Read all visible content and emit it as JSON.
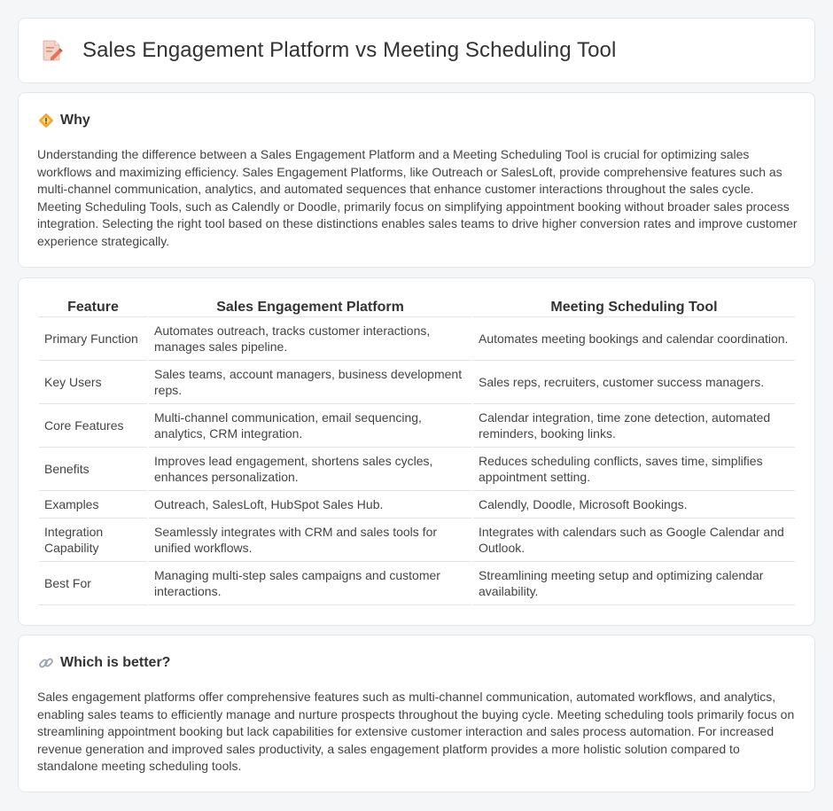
{
  "header": {
    "title": "Sales Engagement Platform vs Meeting Scheduling Tool",
    "icon": "document-pencil-icon"
  },
  "why": {
    "heading": "Why",
    "icon": "diamond-sign-icon",
    "body": "Understanding the difference between a Sales Engagement Platform and a Meeting Scheduling Tool is crucial for optimizing sales workflows and maximizing efficiency. Sales Engagement Platforms, like Outreach or SalesLoft, provide comprehensive features such as multi-channel communication, analytics, and automated sequences that enhance customer interactions throughout the sales cycle. Meeting Scheduling Tools, such as Calendly or Doodle, primarily focus on simplifying appointment booking without broader sales process integration. Selecting the right tool based on these distinctions enables sales teams to drive higher conversion rates and improve customer experience strategically."
  },
  "table": {
    "headers": [
      "Feature",
      "Sales Engagement Platform",
      "Meeting Scheduling Tool"
    ],
    "rows": [
      {
        "feature": "Primary Function",
        "sep": "Automates outreach, tracks customer interactions, manages sales pipeline.",
        "mst": "Automates meeting bookings and calendar coordination."
      },
      {
        "feature": "Key Users",
        "sep": "Sales teams, account managers, business development reps.",
        "mst": "Sales reps, recruiters, customer success managers."
      },
      {
        "feature": "Core Features",
        "sep": "Multi-channel communication, email sequencing, analytics, CRM integration.",
        "mst": "Calendar integration, time zone detection, automated reminders, booking links."
      },
      {
        "feature": "Benefits",
        "sep": "Improves lead engagement, shortens sales cycles, enhances personalization.",
        "mst": "Reduces scheduling conflicts, saves time, simplifies appointment setting."
      },
      {
        "feature": "Examples",
        "sep": "Outreach, SalesLoft, HubSpot Sales Hub.",
        "mst": "Calendly, Doodle, Microsoft Bookings."
      },
      {
        "feature": "Integration Capability",
        "sep": "Seamlessly integrates with CRM and sales tools for unified workflows.",
        "mst": "Integrates with calendars such as Google Calendar and Outlook."
      },
      {
        "feature": "Best For",
        "sep": "Managing multi-step sales campaigns and customer interactions.",
        "mst": "Streamlining meeting setup and optimizing calendar availability."
      }
    ]
  },
  "better": {
    "heading": "Which is better?",
    "icon": "link-icon",
    "body": "Sales engagement platforms offer comprehensive features such as multi-channel communication, automated workflows, and analytics, enabling sales teams to efficiently manage and nurture prospects throughout the buying cycle. Meeting scheduling tools primarily focus on streamlining appointment booking but lack capabilities for extensive customer interaction and sales process automation. For increased revenue generation and improved sales productivity, a sales engagement platform provides a more holistic solution compared to standalone meeting scheduling tools."
  }
}
